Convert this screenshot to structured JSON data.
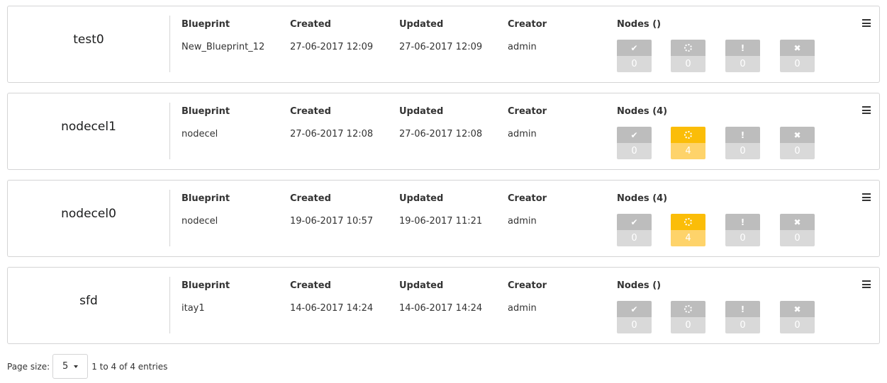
{
  "columns": {
    "blueprint": "Blueprint",
    "created": "Created",
    "updated": "Updated",
    "creator": "Creator"
  },
  "icons": {
    "ok": "check-icon",
    "in_progress": "spinner-icon",
    "warning": "exclamation-icon",
    "failed": "close-icon"
  },
  "colors": {
    "active_top": "#fbbd08",
    "active_bottom": "#fed36a",
    "inactive_top": "#bdbdbd",
    "inactive_bottom": "#d9d9d9"
  },
  "deployments": [
    {
      "name": "test0",
      "blueprint": "New_Blueprint_12",
      "created": "27-06-2017 12:09",
      "updated": "27-06-2017 12:09",
      "creator": "admin",
      "nodes_label": "Nodes ()",
      "counts": {
        "ok": "0",
        "in_progress": "0",
        "warning": "0",
        "failed": "0"
      }
    },
    {
      "name": "nodecel1",
      "blueprint": "nodecel",
      "created": "27-06-2017 12:08",
      "updated": "27-06-2017 12:08",
      "creator": "admin",
      "nodes_label": "Nodes (4)",
      "counts": {
        "ok": "0",
        "in_progress": "4",
        "warning": "0",
        "failed": "0"
      }
    },
    {
      "name": "nodecel0",
      "blueprint": "nodecel",
      "created": "19-06-2017 10:57",
      "updated": "19-06-2017 11:21",
      "creator": "admin",
      "nodes_label": "Nodes (4)",
      "counts": {
        "ok": "0",
        "in_progress": "4",
        "warning": "0",
        "failed": "0"
      }
    },
    {
      "name": "sfd",
      "blueprint": "itay1",
      "created": "14-06-2017 14:24",
      "updated": "14-06-2017 14:24",
      "creator": "admin",
      "nodes_label": "Nodes ()",
      "counts": {
        "ok": "0",
        "in_progress": "0",
        "warning": "0",
        "failed": "0"
      }
    }
  ],
  "footer": {
    "page_size_label": "Page size:",
    "page_size_value": "5",
    "entries_text": "1 to 4 of 4 entries"
  }
}
